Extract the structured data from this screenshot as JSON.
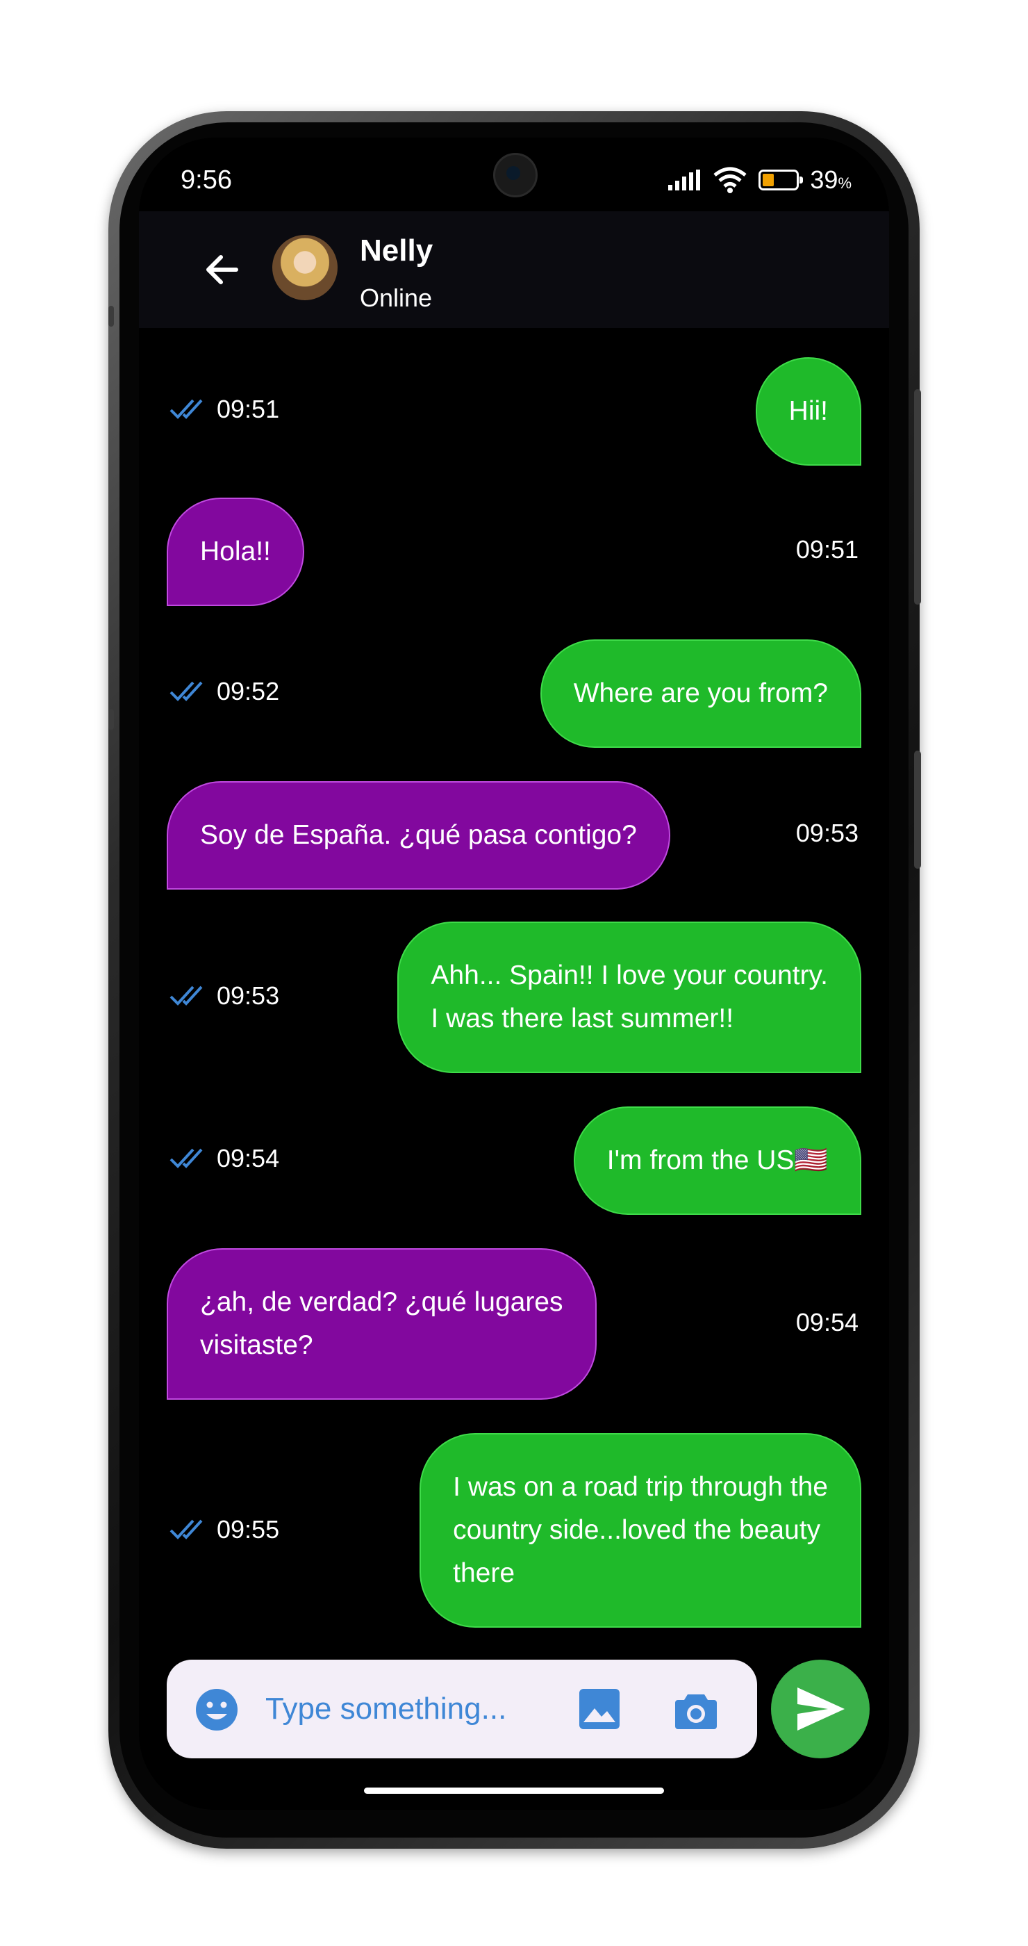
{
  "status_bar": {
    "time": "9:56",
    "battery_percent": "39",
    "battery_sign": "%"
  },
  "header": {
    "contact_name": "Nelly",
    "presence": "Online"
  },
  "messages": [
    {
      "direction": "sent",
      "text": "Hii!",
      "time": "09:51",
      "read": true
    },
    {
      "direction": "received",
      "text": "Hola!!",
      "time": "09:51"
    },
    {
      "direction": "sent",
      "text": "Where are you from?",
      "time": "09:52",
      "read": true
    },
    {
      "direction": "received",
      "text": "Soy de España. ¿qué pasa contigo?",
      "time": "09:53"
    },
    {
      "direction": "sent",
      "text": "Ahh... Spain!! I love your country.\nI was there last summer!!",
      "time": "09:53",
      "read": true
    },
    {
      "direction": "sent",
      "text": "I'm from the US🇺🇸",
      "time": "09:54",
      "read": true
    },
    {
      "direction": "received",
      "text": "¿ah, de verdad? ¿qué lugares\nvisitaste?",
      "time": "09:54"
    },
    {
      "direction": "sent",
      "text": "I was on a road trip through the\ncountry side...loved the beauty\nthere",
      "time": "09:55",
      "read": true
    }
  ],
  "composer": {
    "placeholder": "Type something..."
  },
  "colors": {
    "sent_bubble": "#1fba2a",
    "received_bubble": "#82089e",
    "read_ticks": "#3f87d6",
    "send_button": "#3bb04a",
    "battery_fill": "#f0a000"
  },
  "icons": {
    "back": "arrow-left-icon",
    "emoji": "emoji-icon",
    "gallery": "image-icon",
    "camera": "camera-icon",
    "send": "send-icon",
    "read": "double-check-icon",
    "signal": "signal-icon",
    "wifi": "wifi-icon",
    "battery": "battery-icon"
  }
}
